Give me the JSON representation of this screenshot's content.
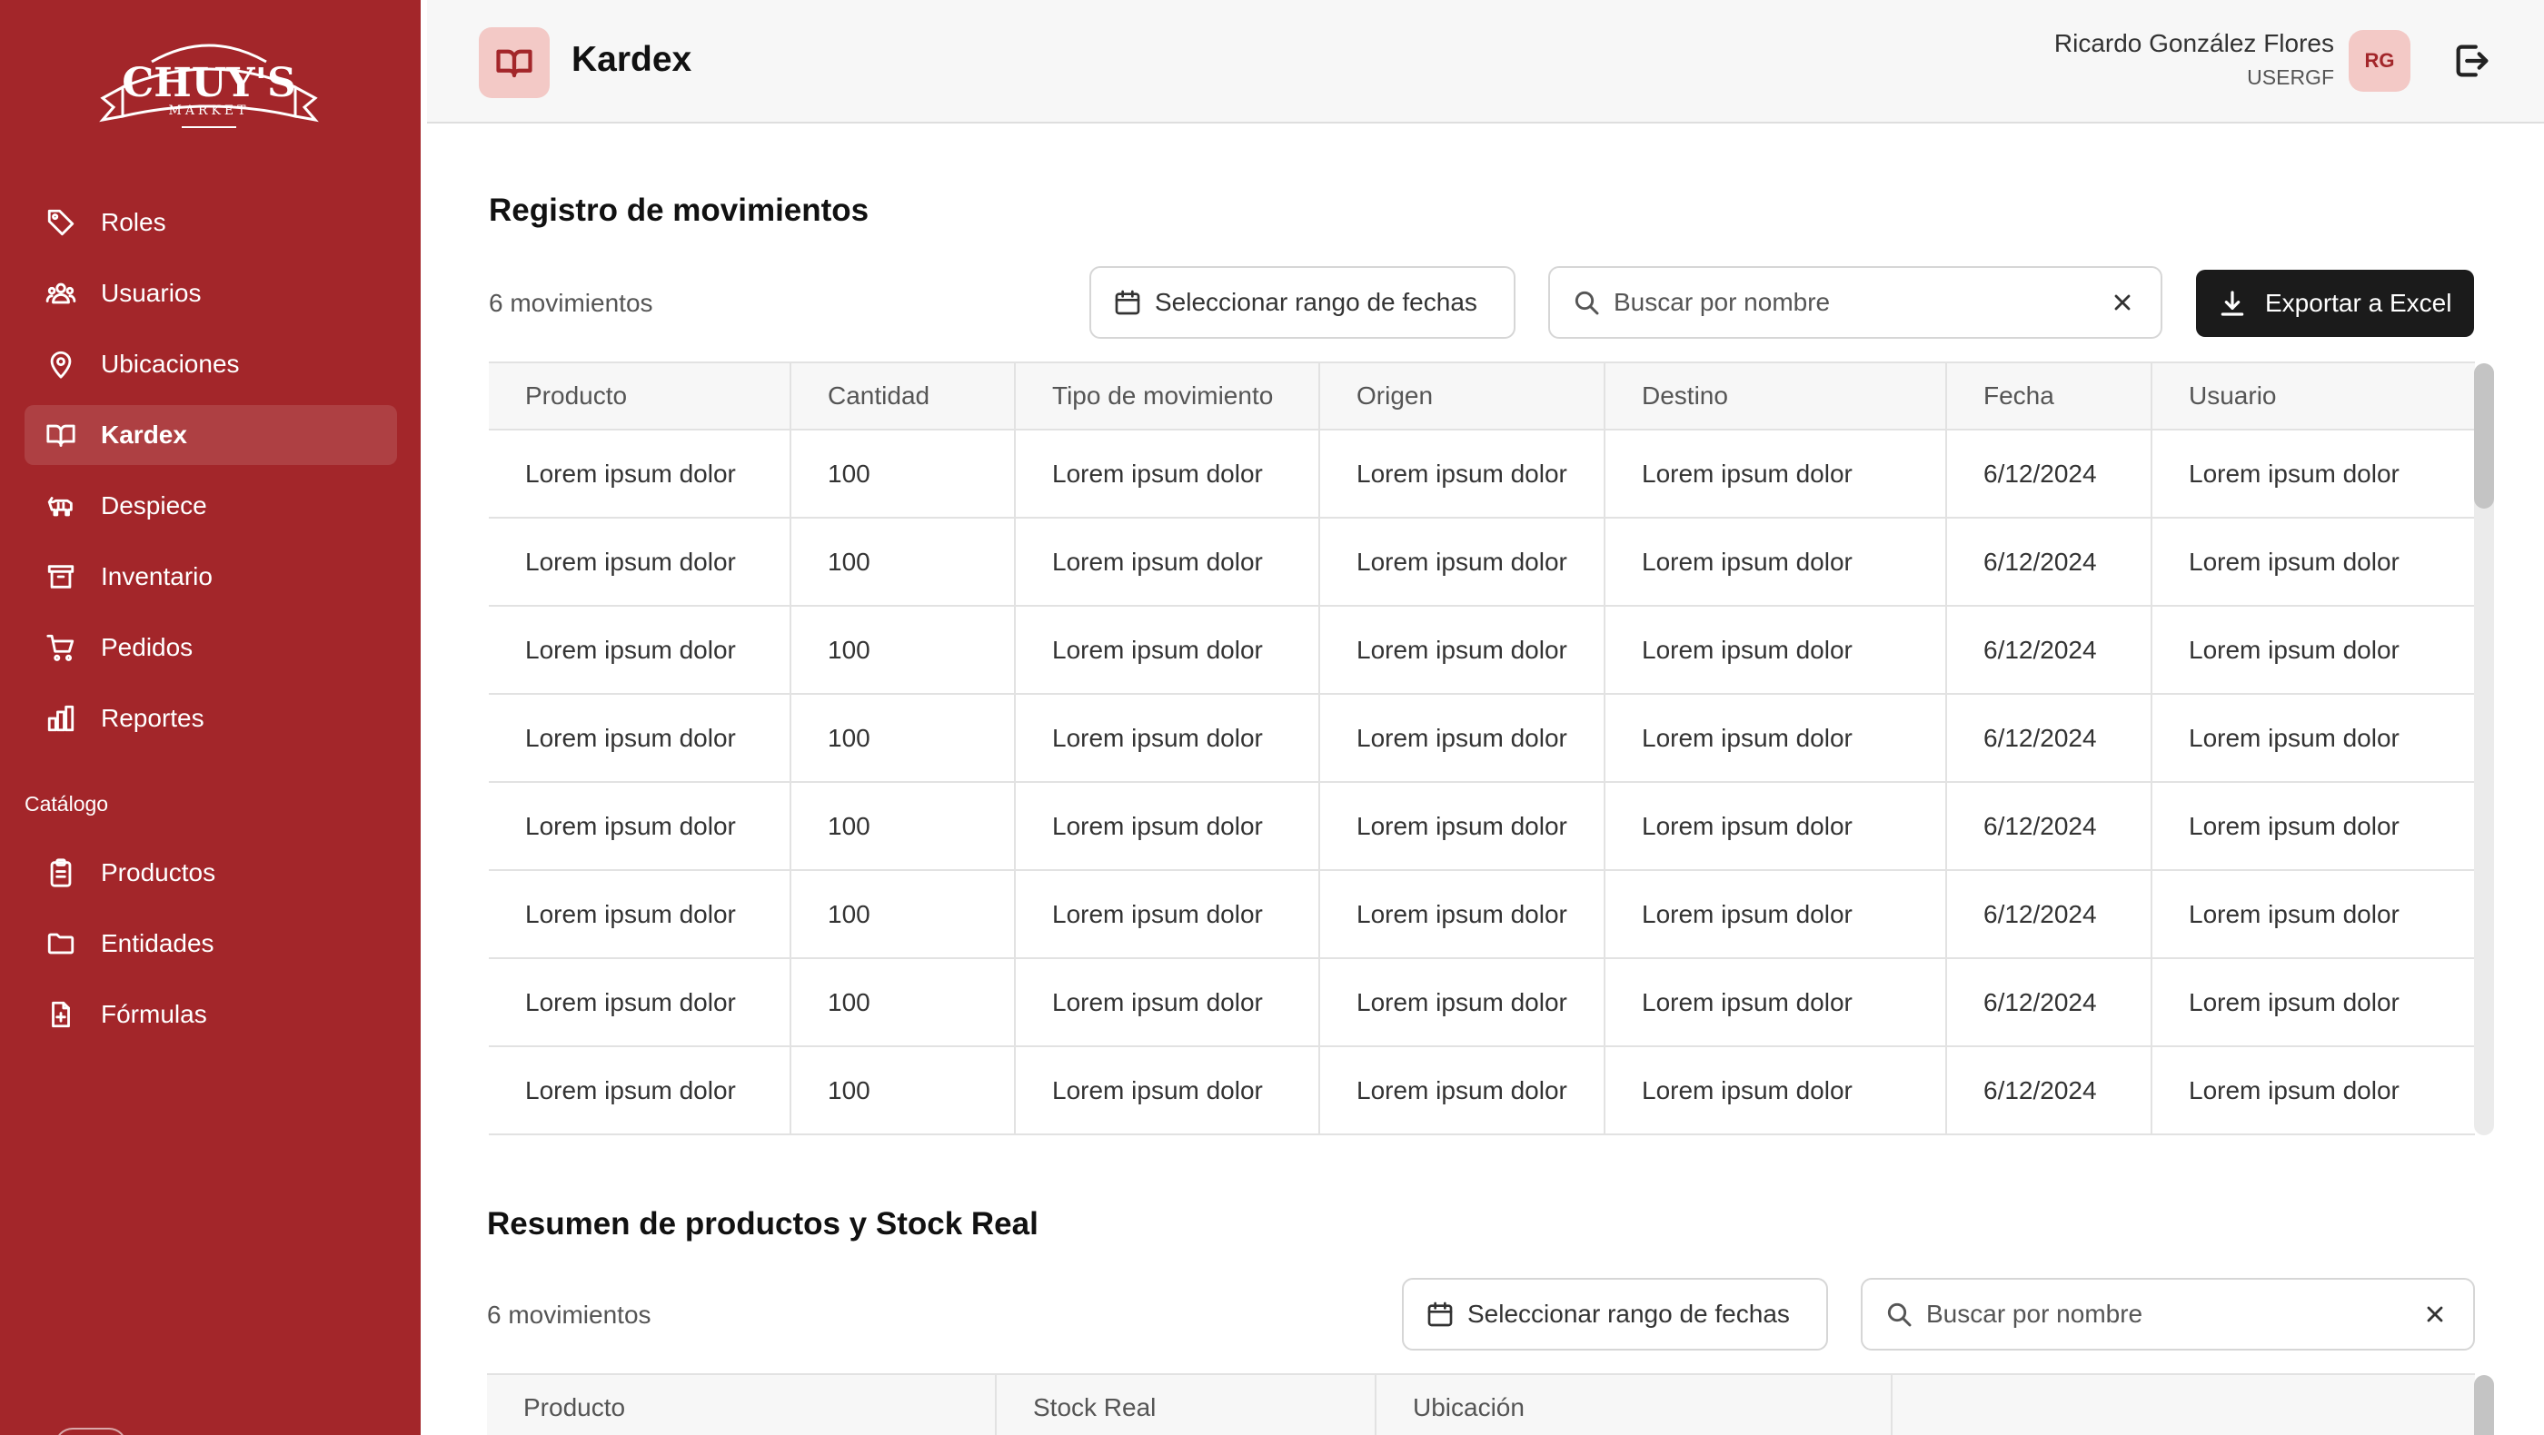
{
  "brand": {
    "logo_text": "CHUY'S",
    "logo_sub": "MARKET"
  },
  "sidebar": {
    "items": [
      {
        "label": "Roles",
        "icon": "tag-icon"
      },
      {
        "label": "Usuarios",
        "icon": "users-icon"
      },
      {
        "label": "Ubicaciones",
        "icon": "location-pin-icon"
      },
      {
        "label": "Kardex",
        "icon": "book-icon",
        "active": true
      },
      {
        "label": "Despiece",
        "icon": "cow-icon"
      },
      {
        "label": "Inventario",
        "icon": "archive-icon"
      },
      {
        "label": "Pedidos",
        "icon": "cart-icon"
      },
      {
        "label": "Reportes",
        "icon": "bar-chart-icon"
      }
    ],
    "catalog_title": "Catálogo",
    "catalog_items": [
      {
        "label": "Productos",
        "icon": "clipboard-icon"
      },
      {
        "label": "Entidades",
        "icon": "folder-icon"
      },
      {
        "label": "Fórmulas",
        "icon": "file-plus-icon"
      }
    ]
  },
  "header": {
    "title": "Kardex",
    "user_name": "Ricardo González Flores",
    "user_id": "USERGF",
    "avatar_initials": "RG"
  },
  "movements": {
    "title": "Registro de movimientos",
    "count_label": "6 movimientos",
    "date_button": "Seleccionar rango de fechas",
    "search_placeholder": "Buscar por nombre",
    "export_button": "Exportar a Excel",
    "columns": [
      "Producto",
      "Cantidad",
      "Tipo de movimiento",
      "Origen",
      "Destino",
      "Fecha",
      "Usuario"
    ],
    "rows": [
      [
        "Lorem ipsum dolor",
        "100",
        "Lorem ipsum dolor",
        "Lorem ipsum dolor",
        "Lorem ipsum dolor",
        "6/12/2024",
        "Lorem ipsum dolor"
      ],
      [
        "Lorem ipsum dolor",
        "100",
        "Lorem ipsum dolor",
        "Lorem ipsum dolor",
        "Lorem ipsum dolor",
        "6/12/2024",
        "Lorem ipsum dolor"
      ],
      [
        "Lorem ipsum dolor",
        "100",
        "Lorem ipsum dolor",
        "Lorem ipsum dolor",
        "Lorem ipsum dolor",
        "6/12/2024",
        "Lorem ipsum dolor"
      ],
      [
        "Lorem ipsum dolor",
        "100",
        "Lorem ipsum dolor",
        "Lorem ipsum dolor",
        "Lorem ipsum dolor",
        "6/12/2024",
        "Lorem ipsum dolor"
      ],
      [
        "Lorem ipsum dolor",
        "100",
        "Lorem ipsum dolor",
        "Lorem ipsum dolor",
        "Lorem ipsum dolor",
        "6/12/2024",
        "Lorem ipsum dolor"
      ],
      [
        "Lorem ipsum dolor",
        "100",
        "Lorem ipsum dolor",
        "Lorem ipsum dolor",
        "Lorem ipsum dolor",
        "6/12/2024",
        "Lorem ipsum dolor"
      ],
      [
        "Lorem ipsum dolor",
        "100",
        "Lorem ipsum dolor",
        "Lorem ipsum dolor",
        "Lorem ipsum dolor",
        "6/12/2024",
        "Lorem ipsum dolor"
      ],
      [
        "Lorem ipsum dolor",
        "100",
        "Lorem ipsum dolor",
        "Lorem ipsum dolor",
        "Lorem ipsum dolor",
        "6/12/2024",
        "Lorem ipsum dolor"
      ]
    ]
  },
  "stock": {
    "title": "Resumen de productos y Stock Real",
    "count_label": "6 movimientos",
    "date_button": "Seleccionar rango de fechas",
    "search_placeholder": "Buscar por nombre",
    "columns": [
      "Producto",
      "Stock Real",
      "Ubicación",
      ""
    ]
  },
  "colors": {
    "brand_red": "#a3262a",
    "avatar_bg": "#f3c9c6",
    "dark_button": "#1b1b1b"
  }
}
